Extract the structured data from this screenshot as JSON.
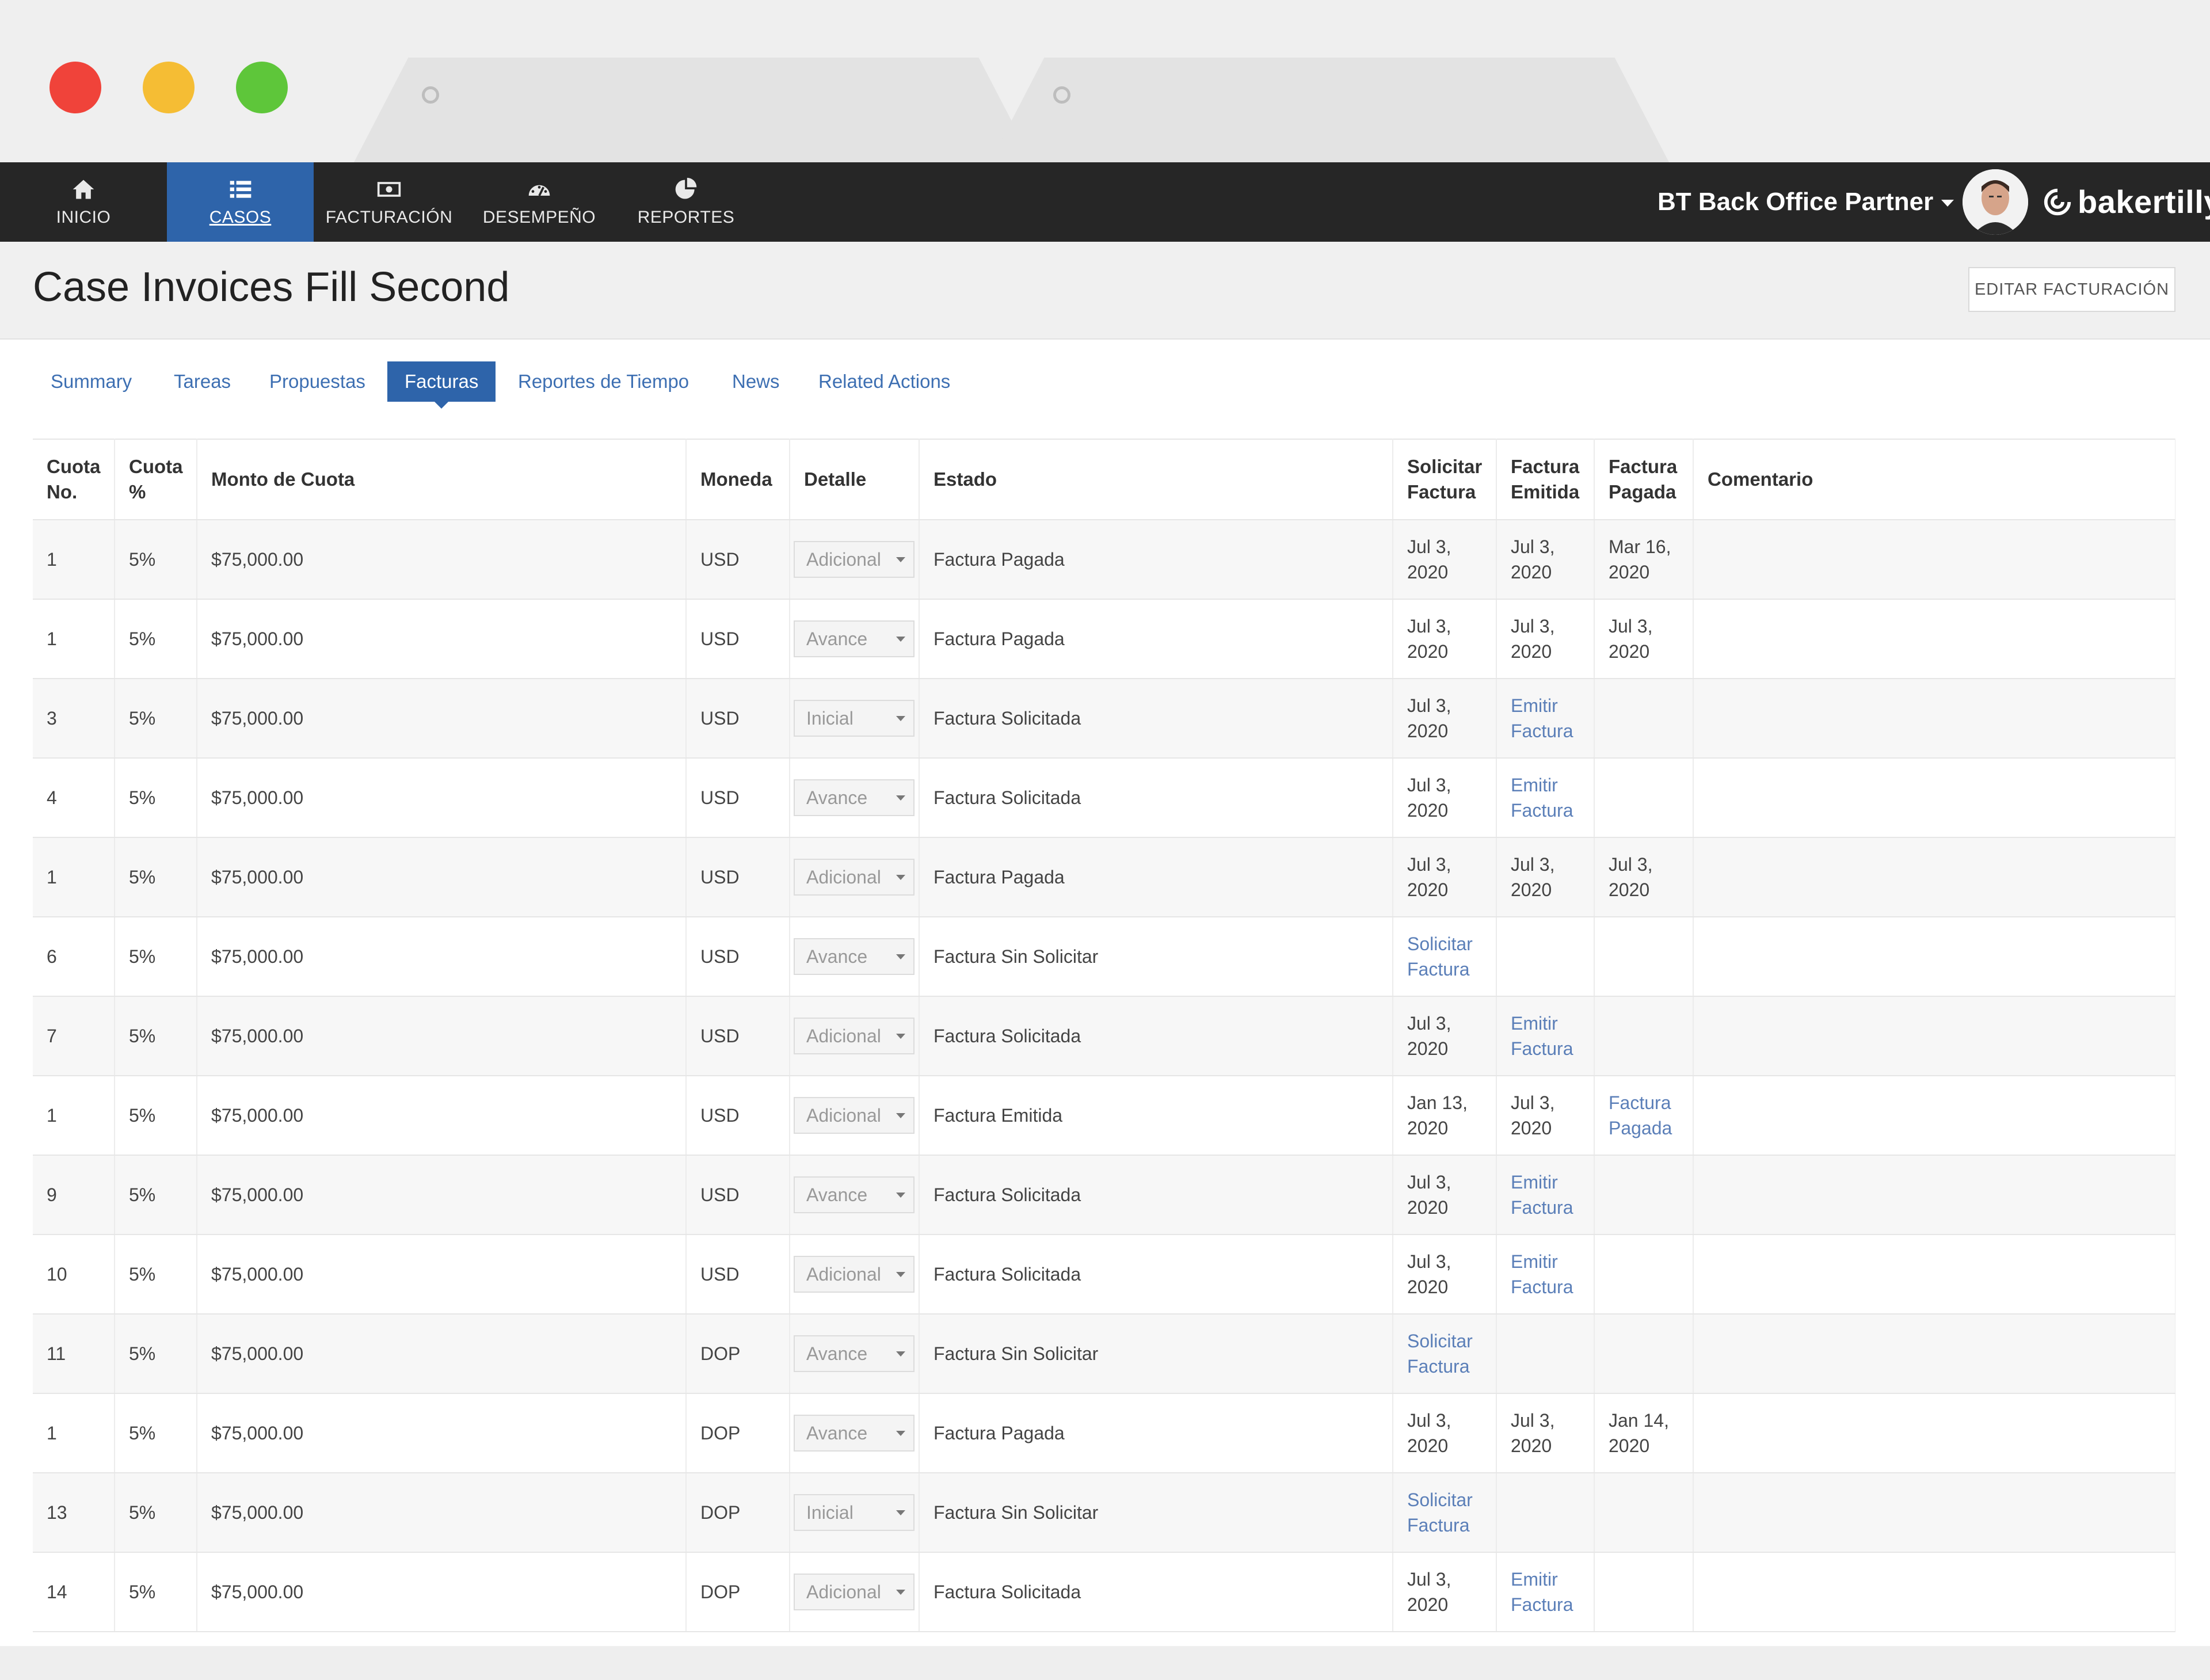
{
  "nav": {
    "items": [
      {
        "label": "INICIO",
        "icon": "home-icon"
      },
      {
        "label": "CASOS",
        "icon": "list-icon"
      },
      {
        "label": "FACTURACIÓN",
        "icon": "money-icon"
      },
      {
        "label": "DESEMPEÑO",
        "icon": "dashboard-icon"
      },
      {
        "label": "REPORTES",
        "icon": "pie-chart-icon"
      }
    ],
    "active": "CASOS",
    "user_menu": "BT Back Office Partner",
    "brand": "bakertilly"
  },
  "header": {
    "title": "Case Invoices Fill Second",
    "edit_button": "EDITAR FACTURACIÓN"
  },
  "subtabs": {
    "items": [
      "Summary",
      "Tareas",
      "Propuestas",
      "Facturas",
      "Reportes de Tiempo",
      "News",
      "Related Actions"
    ],
    "active": "Facturas"
  },
  "table": {
    "headers": {
      "cuota_no": [
        "Cuota",
        "No."
      ],
      "cuota_pct": [
        "Cuota",
        "%"
      ],
      "monto": "Monto de Cuota",
      "moneda": "Moneda",
      "detalle": "Detalle",
      "estado": "Estado",
      "solicitar": [
        "Solicitar",
        "Factura"
      ],
      "emitida": [
        "Factura",
        "Emitida"
      ],
      "pagada": [
        "Factura",
        "Pagada"
      ],
      "comentario": "Comentario"
    },
    "rows": [
      {
        "no": "1",
        "pct": "5%",
        "monto": "$75,000.00",
        "moneda": "USD",
        "detalle": "Adicional",
        "estado": "Factura Pagada",
        "solicitar": [
          "Jul 3,",
          "2020"
        ],
        "emitida": [
          "Jul 3,",
          "2020"
        ],
        "pagada": [
          "Mar 16,",
          "2020"
        ]
      },
      {
        "no": "1",
        "pct": "5%",
        "monto": "$75,000.00",
        "moneda": "USD",
        "detalle": "Avance",
        "estado": "Factura Pagada",
        "solicitar": [
          "Jul 3,",
          "2020"
        ],
        "emitida": [
          "Jul 3,",
          "2020"
        ],
        "pagada": [
          "Jul 3,",
          "2020"
        ]
      },
      {
        "no": "3",
        "pct": "5%",
        "monto": "$75,000.00",
        "moneda": "USD",
        "detalle": "Inicial",
        "estado": "Factura Solicitada",
        "solicitar": [
          "Jul 3,",
          "2020"
        ],
        "emitida_link": [
          "Emitir",
          "Factura"
        ]
      },
      {
        "no": "4",
        "pct": "5%",
        "monto": "$75,000.00",
        "moneda": "USD",
        "detalle": "Avance",
        "estado": "Factura Solicitada",
        "solicitar": [
          "Jul 3,",
          "2020"
        ],
        "emitida_link": [
          "Emitir",
          "Factura"
        ]
      },
      {
        "no": "1",
        "pct": "5%",
        "monto": "$75,000.00",
        "moneda": "USD",
        "detalle": "Adicional",
        "estado": "Factura Pagada",
        "solicitar": [
          "Jul 3,",
          "2020"
        ],
        "emitida": [
          "Jul 3,",
          "2020"
        ],
        "pagada": [
          "Jul 3,",
          "2020"
        ]
      },
      {
        "no": "6",
        "pct": "5%",
        "monto": "$75,000.00",
        "moneda": "USD",
        "detalle": "Avance",
        "estado": "Factura Sin Solicitar",
        "solicitar_link": [
          "Solicitar",
          "Factura"
        ]
      },
      {
        "no": "7",
        "pct": "5%",
        "monto": "$75,000.00",
        "moneda": "USD",
        "detalle": "Adicional",
        "estado": "Factura Solicitada",
        "solicitar": [
          "Jul 3,",
          "2020"
        ],
        "emitida_link": [
          "Emitir",
          "Factura"
        ]
      },
      {
        "no": "1",
        "pct": "5%",
        "monto": "$75,000.00",
        "moneda": "USD",
        "detalle": "Adicional",
        "estado": "Factura Emitida",
        "solicitar": [
          "Jan 13,",
          "2020"
        ],
        "emitida": [
          "Jul 3,",
          "2020"
        ],
        "pagada_link": [
          "Factura",
          "Pagada"
        ]
      },
      {
        "no": "9",
        "pct": "5%",
        "monto": "$75,000.00",
        "moneda": "USD",
        "detalle": "Avance",
        "estado": "Factura Solicitada",
        "solicitar": [
          "Jul 3,",
          "2020"
        ],
        "emitida_link": [
          "Emitir",
          "Factura"
        ]
      },
      {
        "no": "10",
        "pct": "5%",
        "monto": "$75,000.00",
        "moneda": "USD",
        "detalle": "Adicional",
        "estado": "Factura Solicitada",
        "solicitar": [
          "Jul 3,",
          "2020"
        ],
        "emitida_link": [
          "Emitir",
          "Factura"
        ]
      },
      {
        "no": "11",
        "pct": "5%",
        "monto": "$75,000.00",
        "moneda": "DOP",
        "detalle": "Avance",
        "estado": "Factura Sin Solicitar",
        "solicitar_link": [
          "Solicitar",
          "Factura"
        ]
      },
      {
        "no": "1",
        "pct": "5%",
        "monto": "$75,000.00",
        "moneda": "DOP",
        "detalle": "Avance",
        "estado": "Factura Pagada",
        "solicitar": [
          "Jul 3,",
          "2020"
        ],
        "emitida": [
          "Jul 3,",
          "2020"
        ],
        "pagada": [
          "Jan 14,",
          "2020"
        ]
      },
      {
        "no": "13",
        "pct": "5%",
        "monto": "$75,000.00",
        "moneda": "DOP",
        "detalle": "Inicial",
        "estado": "Factura Sin Solicitar",
        "solicitar_link": [
          "Solicitar",
          "Factura"
        ]
      },
      {
        "no": "14",
        "pct": "5%",
        "monto": "$75,000.00",
        "moneda": "DOP",
        "detalle": "Adicional",
        "estado": "Factura Solicitada",
        "solicitar": [
          "Jul 3,",
          "2020"
        ],
        "emitida_link": [
          "Emitir",
          "Factura"
        ]
      }
    ]
  },
  "colors": {
    "nav_bg": "#262626",
    "nav_active": "#2e64aa",
    "link": "#5b7fb8",
    "tab_link": "#3d6fb2"
  }
}
